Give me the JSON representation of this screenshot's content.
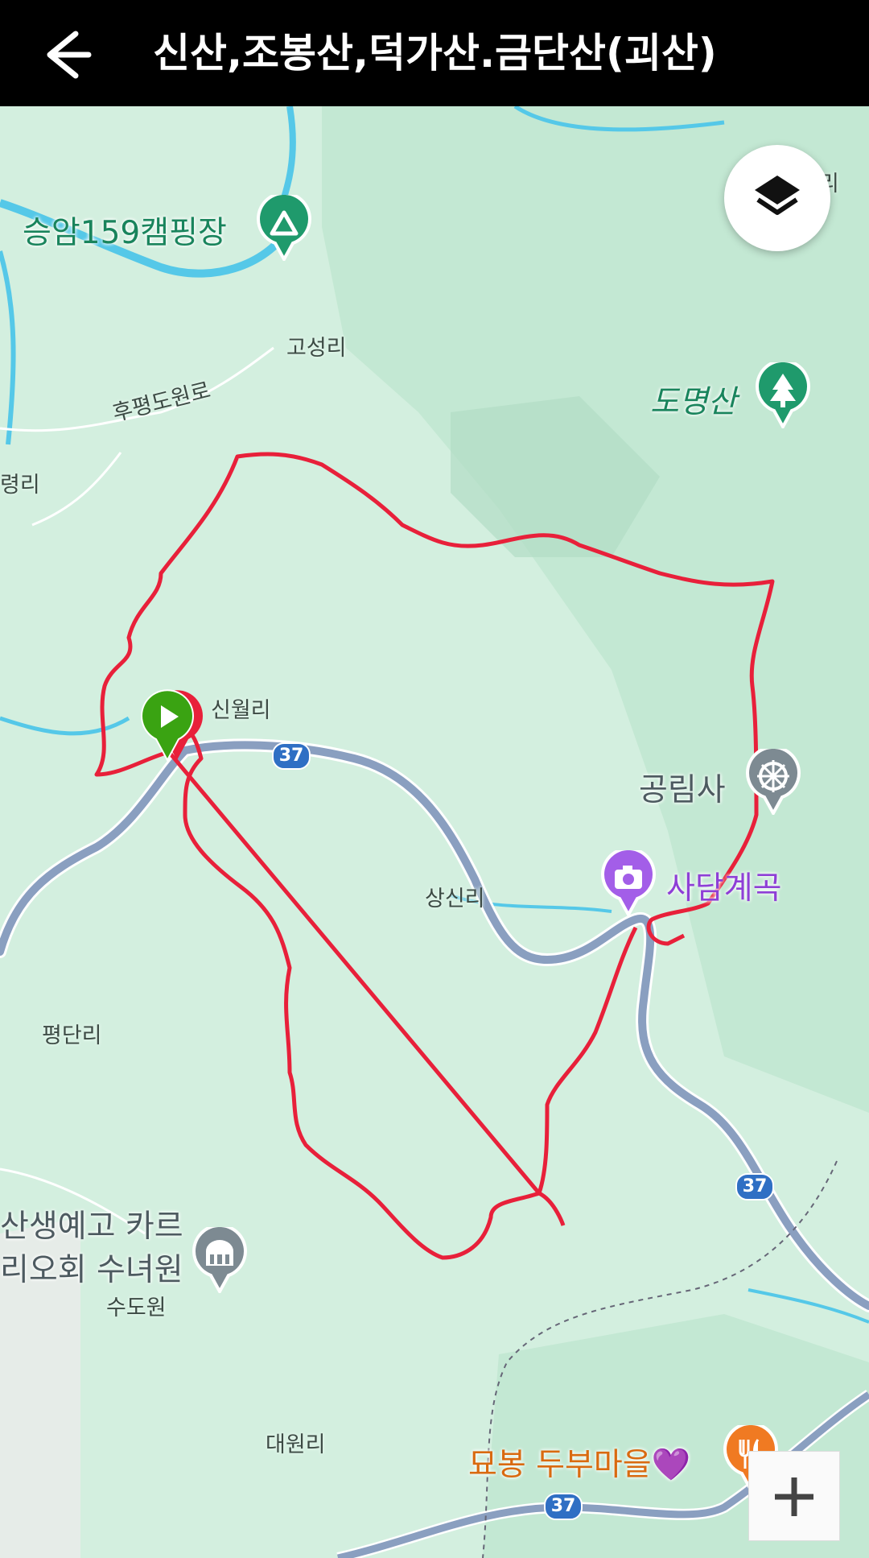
{
  "header": {
    "title": "신산,조봉산,덕가산.금단산(괴산)",
    "back_icon": "arrow-left-icon"
  },
  "map": {
    "poi": {
      "camping": "승암159캠핑장",
      "mountain": "도명산",
      "temple": "공림사",
      "valley": "사담계곡",
      "convent_line1": "산생예고 카르",
      "convent_line2": "리오회 수녀원",
      "convent_sub": "수도원",
      "restaurant": "묘봉 두부마을💜"
    },
    "places": {
      "goseong": "고성리",
      "hupyeong_road": "후평도원로",
      "left_edge": "령리",
      "sinwol": "신월리",
      "sangsin": "상신리",
      "pyeongdan": "평단리",
      "daewon": "대원리",
      "top_right": "리"
    },
    "route_shields": [
      "37",
      "37",
      "37"
    ],
    "icons": {
      "layers": "layers-icon",
      "zoom_in": "plus-icon",
      "start": "start-flag-icon",
      "camping": "campground-icon",
      "mountain": "tree-icon",
      "temple": "dharma-wheel-icon",
      "valley": "camera-icon",
      "convent": "building-icon",
      "restaurant": "fork-knife-icon"
    },
    "colors": {
      "track": "#e8203a",
      "road": "#8a9fc0",
      "water": "#55c8e8",
      "terrain": "#cfeedd",
      "start_pin": "#3aa312"
    }
  }
}
